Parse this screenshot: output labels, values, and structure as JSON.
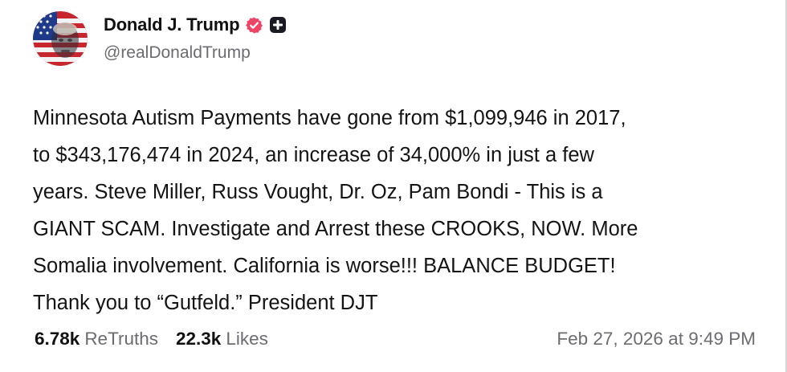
{
  "post": {
    "author": {
      "display_name": "Donald J. Trump",
      "handle": "@realDonaldTrump",
      "avatar_icon": "flag-portrait-avatar",
      "verified_icon": "verified-badge-icon",
      "verified_color": "#ee4466",
      "badge_icon": "plus-badge-icon"
    },
    "text": "Minnesota Autism Payments have gone from $1,099,946 in 2017,\nto $343,176,474 in 2024, an increase of 34,000% in just a few\nyears. Steve Miller, Russ Vought, Dr. Oz, Pam Bondi - This is a\nGIANT SCAM. Investigate and Arrest these CROOKS, NOW. More\nSomalia involvement. California is worse!!! BALANCE BUDGET!\nThank you to “Gutfeld.” President DJT",
    "stats": {
      "retruths_count": "6.78k",
      "retruths_label": "ReTruths",
      "likes_count": "22.3k",
      "likes_label": "Likes"
    },
    "timestamp": "Feb 27, 2026 at 9:49 PM"
  }
}
